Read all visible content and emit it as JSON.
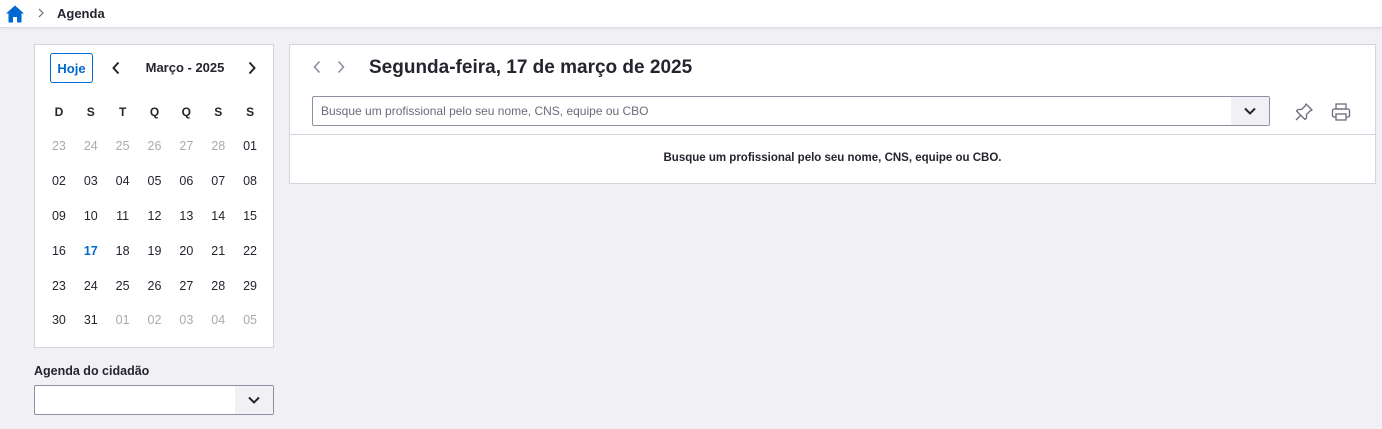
{
  "breadcrumb": {
    "current": "Agenda"
  },
  "calendar": {
    "today_label": "Hoje",
    "month_label": "Março - 2025",
    "weekdays": [
      "D",
      "S",
      "T",
      "Q",
      "Q",
      "S",
      "S"
    ],
    "days": [
      {
        "d": "23",
        "muted": true
      },
      {
        "d": "24",
        "muted": true
      },
      {
        "d": "25",
        "muted": true
      },
      {
        "d": "26",
        "muted": true
      },
      {
        "d": "27",
        "muted": true
      },
      {
        "d": "28",
        "muted": true
      },
      {
        "d": "01"
      },
      {
        "d": "02"
      },
      {
        "d": "03"
      },
      {
        "d": "04"
      },
      {
        "d": "05"
      },
      {
        "d": "06"
      },
      {
        "d": "07"
      },
      {
        "d": "08"
      },
      {
        "d": "09"
      },
      {
        "d": "10"
      },
      {
        "d": "11"
      },
      {
        "d": "12"
      },
      {
        "d": "13"
      },
      {
        "d": "14"
      },
      {
        "d": "15"
      },
      {
        "d": "16"
      },
      {
        "d": "17",
        "today": true
      },
      {
        "d": "18"
      },
      {
        "d": "19"
      },
      {
        "d": "20"
      },
      {
        "d": "21"
      },
      {
        "d": "22"
      },
      {
        "d": "23"
      },
      {
        "d": "24"
      },
      {
        "d": "25"
      },
      {
        "d": "26"
      },
      {
        "d": "27"
      },
      {
        "d": "28"
      },
      {
        "d": "29"
      },
      {
        "d": "30"
      },
      {
        "d": "31"
      },
      {
        "d": "01",
        "muted": true
      },
      {
        "d": "02",
        "muted": true
      },
      {
        "d": "03",
        "muted": true
      },
      {
        "d": "04",
        "muted": true
      },
      {
        "d": "05",
        "muted": true
      }
    ]
  },
  "citizen_agenda": {
    "label": "Agenda do cidadão",
    "value": ""
  },
  "main": {
    "date_title": "Segunda-feira, 17 de março de 2025",
    "search_placeholder": "Busque um profissional pelo seu nome, CNS, equipe ou CBO",
    "empty_message": "Busque um profissional pelo seu nome, CNS, equipe ou CBO."
  },
  "colors": {
    "accent": "#0069d0",
    "background": "#f0f0f5",
    "muted_day": "#a9a9b2"
  }
}
